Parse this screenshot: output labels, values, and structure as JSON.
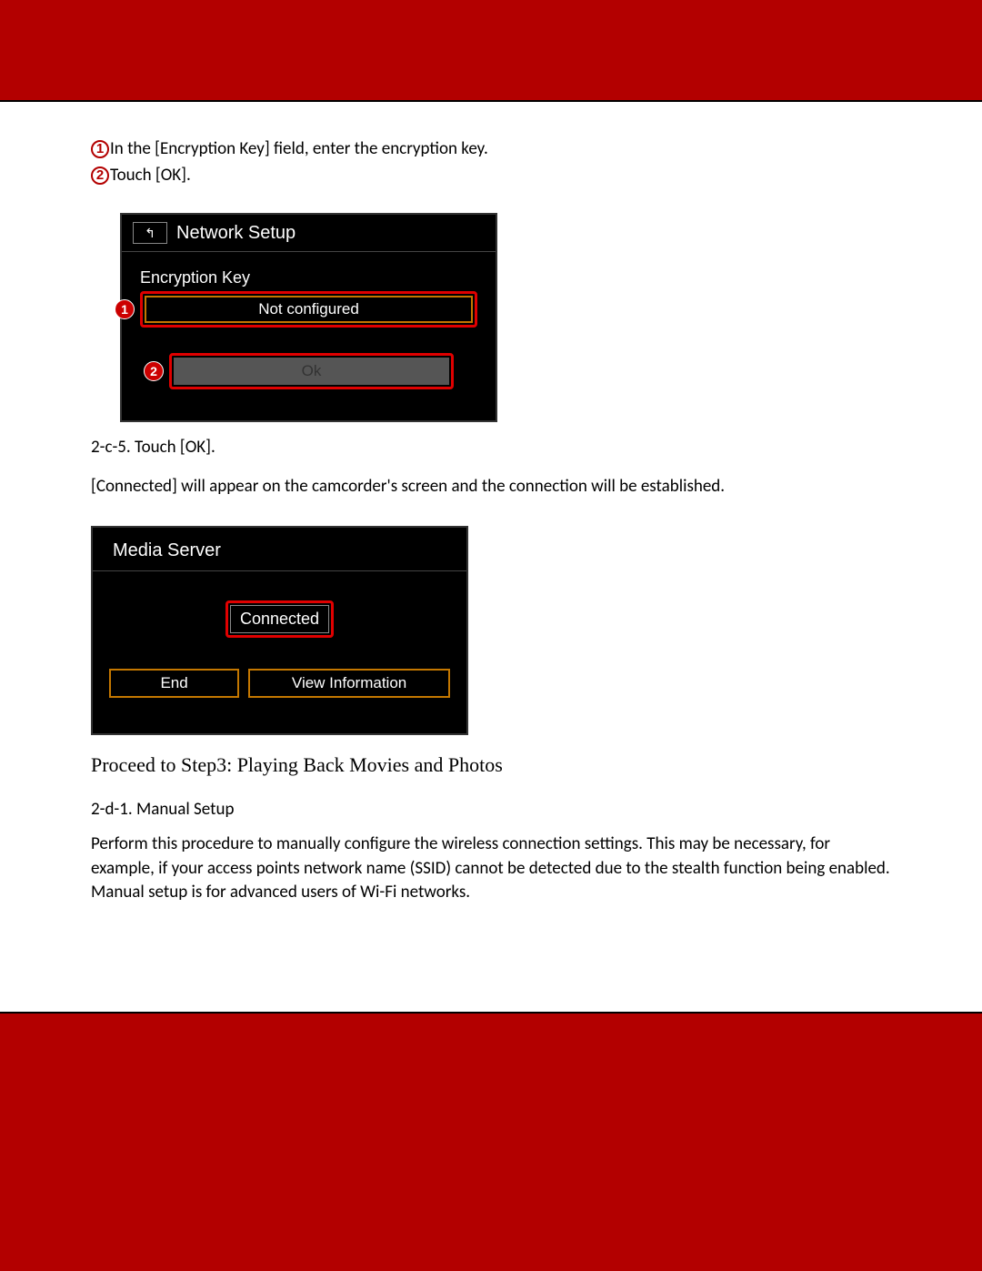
{
  "steps": {
    "s1": "In the [Encryption Key] field, enter the encryption key.",
    "s2": "Touch [OK]."
  },
  "screen1": {
    "title": "Network Setup",
    "field_label": "Encryption Key",
    "field_value": "Not configured",
    "ok_label": "Ok",
    "callout1": "1",
    "callout2": "2"
  },
  "text_2c5": "2-c-5. Touch [OK].",
  "text_connected": "[Connected] will appear on the camcorder's screen and the connection will be established.",
  "screen2": {
    "title": "Media Server",
    "status": "Connected",
    "end": "End",
    "view": "View Information"
  },
  "proceed": "Proceed to Step3: Playing Back Movies and Photos",
  "section_2d1_title": "2-d-1. Manual Setup",
  "section_2d1_body": "Perform this procedure to manually configure the wireless connection settings. This may be necessary, for example, if your access points network name (SSID) cannot be detected due to the stealth function being enabled. Manual setup is for advanced users of Wi-Fi networks."
}
